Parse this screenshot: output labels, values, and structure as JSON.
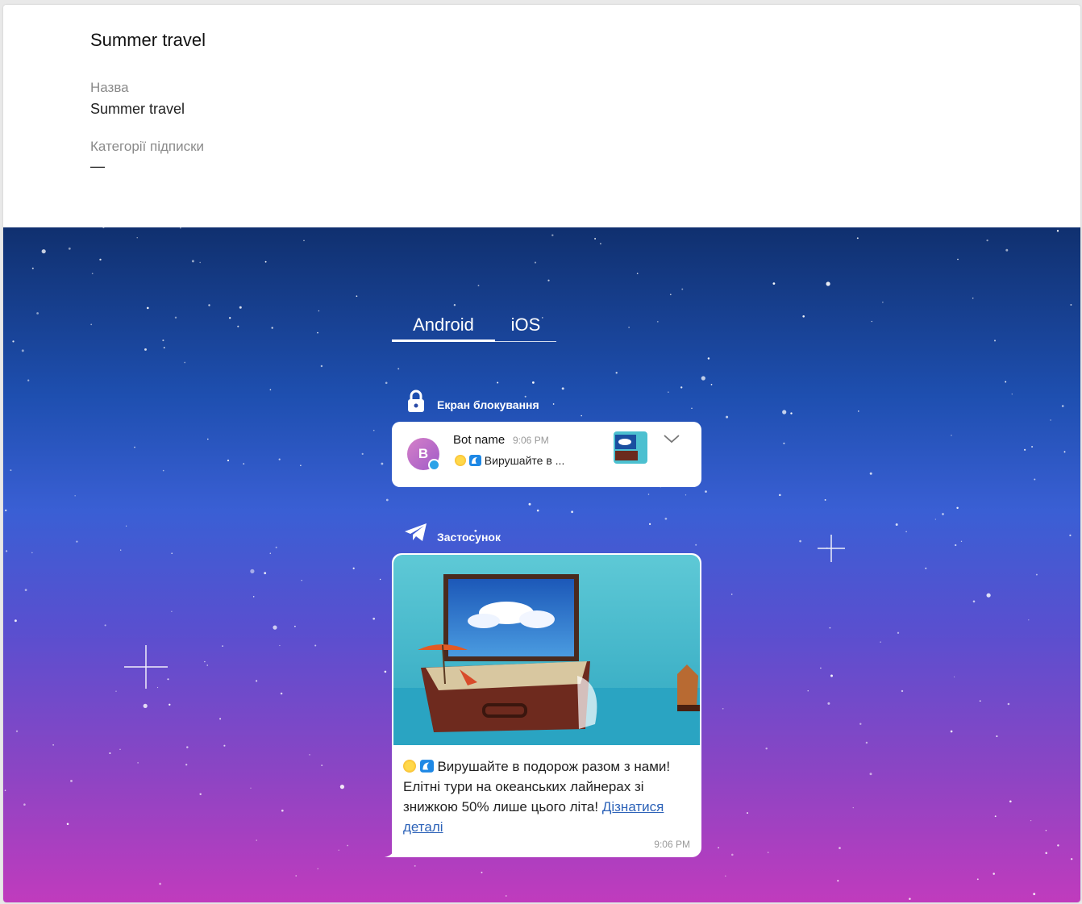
{
  "info": {
    "title": "Summer travel",
    "name_label": "Назва",
    "name_value": "Summer travel",
    "categories_label": "Категорії підписки",
    "categories_value": "—"
  },
  "tabs": [
    {
      "label": "Android",
      "active": true
    },
    {
      "label": "iOS",
      "active": false
    }
  ],
  "lock_screen": {
    "label": "Екран блокування",
    "icon": "lock-icon"
  },
  "notification": {
    "avatar_letter": "B",
    "bot_name": "Bot name",
    "time": "9:06 PM",
    "preview_text": "Вирушайте в ..."
  },
  "app": {
    "label": "Застосунок",
    "icon": "telegram-icon"
  },
  "message": {
    "text": "Вирушайте в подорож разом з нами! Елітні тури на океанських лайнерах зі знижкою 50% лише цього літа! ",
    "link": "Дізнатися деталі",
    "time": "9:06 PM"
  },
  "colors": {
    "gradient_top": "#10306f",
    "gradient_bottom": "#c03bbd",
    "link": "#2c62b8"
  }
}
